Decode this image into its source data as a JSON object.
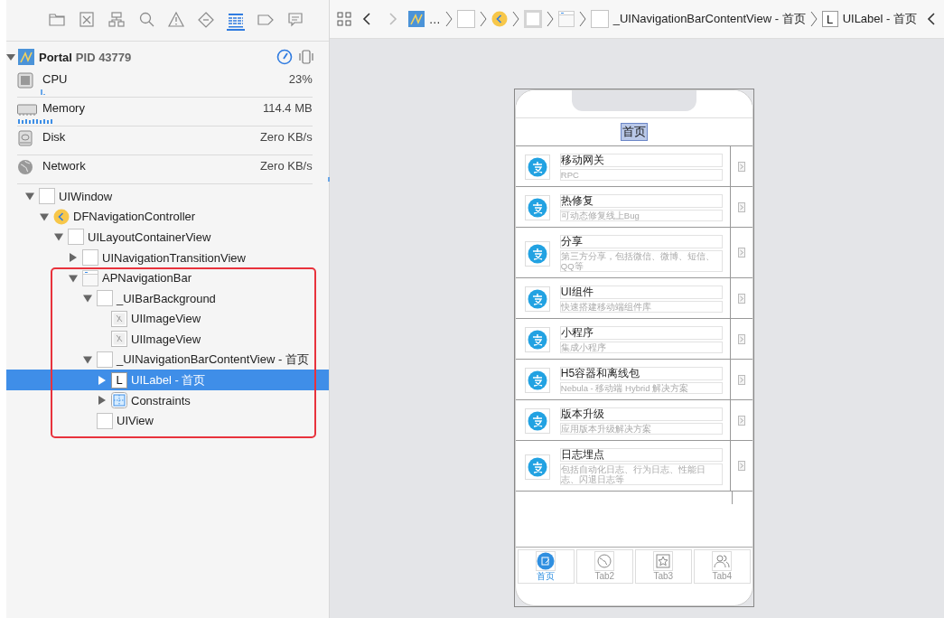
{
  "navigator_tabs": [
    {
      "kind": "folder",
      "selected": false
    },
    {
      "kind": "square-x",
      "selected": false
    },
    {
      "kind": "hierarchy",
      "selected": false
    },
    {
      "kind": "search",
      "selected": false
    },
    {
      "kind": "warning",
      "selected": false
    },
    {
      "kind": "diamond",
      "selected": false
    },
    {
      "kind": "list",
      "selected": true
    },
    {
      "kind": "tag",
      "selected": false
    },
    {
      "kind": "bubble",
      "selected": false
    }
  ],
  "process": {
    "name": "Portal",
    "pid": "PID 43779",
    "expanded": true
  },
  "gauges": [
    {
      "kind": "cpu",
      "label": "CPU",
      "value": "23%"
    },
    {
      "kind": "memory",
      "label": "Memory",
      "value": "114.4 MB"
    },
    {
      "kind": "disk",
      "label": "Disk",
      "value": "Zero KB/s"
    },
    {
      "kind": "network",
      "label": "Network",
      "value": "Zero KB/s"
    }
  ],
  "tree": [
    {
      "label": "UIWindow",
      "kind": "view",
      "expanded": true,
      "selected": false,
      "children": [
        {
          "label": "DFNavigationController",
          "kind": "controller",
          "expanded": true,
          "selected": false,
          "children": [
            {
              "label": "UILayoutContainerView",
              "kind": "view",
              "expanded": true,
              "selected": false,
              "children": [
                {
                  "label": "UINavigationTransitionView",
                  "kind": "view",
                  "expanded": false,
                  "selected": false
                },
                {
                  "label": "APNavigationBar",
                  "kind": "navbar",
                  "expanded": true,
                  "selected": false,
                  "outlined": true,
                  "children": [
                    {
                      "label": "_UIBarBackground",
                      "kind": "view",
                      "expanded": true,
                      "selected": false,
                      "children": [
                        {
                          "label": "UIImageView",
                          "kind": "image",
                          "selected": false
                        },
                        {
                          "label": "UIImageView",
                          "kind": "image",
                          "selected": false
                        }
                      ]
                    },
                    {
                      "label": "_UINavigationBarContentView - 首页",
                      "kind": "view",
                      "expanded": true,
                      "selected": false,
                      "children": [
                        {
                          "label": "UILabel - 首页",
                          "kind": "label",
                          "glyph": "L",
                          "expanded": false,
                          "selected": true
                        },
                        {
                          "label": "Constraints",
                          "kind": "constraints",
                          "expanded": false,
                          "selected": false
                        }
                      ]
                    },
                    {
                      "label": "UIView",
                      "kind": "view",
                      "selected": false
                    }
                  ]
                }
              ]
            }
          ]
        }
      ]
    }
  ],
  "breadcrumb": {
    "back": {
      "disabled": false
    },
    "forward": {
      "disabled": true
    },
    "items": [
      {
        "kind": "app",
        "label": "…"
      },
      {
        "kind": "view"
      },
      {
        "kind": "controller"
      },
      {
        "kind": "container"
      },
      {
        "kind": "navbar"
      },
      {
        "kind": "view",
        "label": "_UINavigationBarContentView - 首页"
      },
      {
        "kind": "label",
        "glyph": "L",
        "label": "UILabel - 首页"
      }
    ]
  },
  "phone": {
    "nav_title": "首页",
    "title_selected": true,
    "rows": [
      {
        "title": "移动网关",
        "subtitle": "RPC"
      },
      {
        "title": "热修复",
        "subtitle": "可动态修复线上Bug"
      },
      {
        "title": "分享",
        "subtitle": "第三方分享，包括微信、微博、短信、QQ等"
      },
      {
        "title": "UI组件",
        "subtitle": "快速搭建移动端组件库"
      },
      {
        "title": "小程序",
        "subtitle": "集成小程序"
      },
      {
        "title": "H5容器和离线包",
        "subtitle": "Nebula - 移动端 Hybrid 解决方案"
      },
      {
        "title": "版本升级",
        "subtitle": "应用版本升级解决方案"
      },
      {
        "title": "日志埋点",
        "subtitle": "包括自动化日志、行为日志、性能日志、闪退日志等"
      }
    ],
    "tabs": [
      {
        "label": "首页",
        "kind": "home",
        "selected": true
      },
      {
        "label": "Tab2",
        "kind": "globe",
        "selected": false
      },
      {
        "label": "Tab3",
        "kind": "star",
        "selected": false
      },
      {
        "label": "Tab4",
        "kind": "people",
        "selected": false
      }
    ]
  }
}
